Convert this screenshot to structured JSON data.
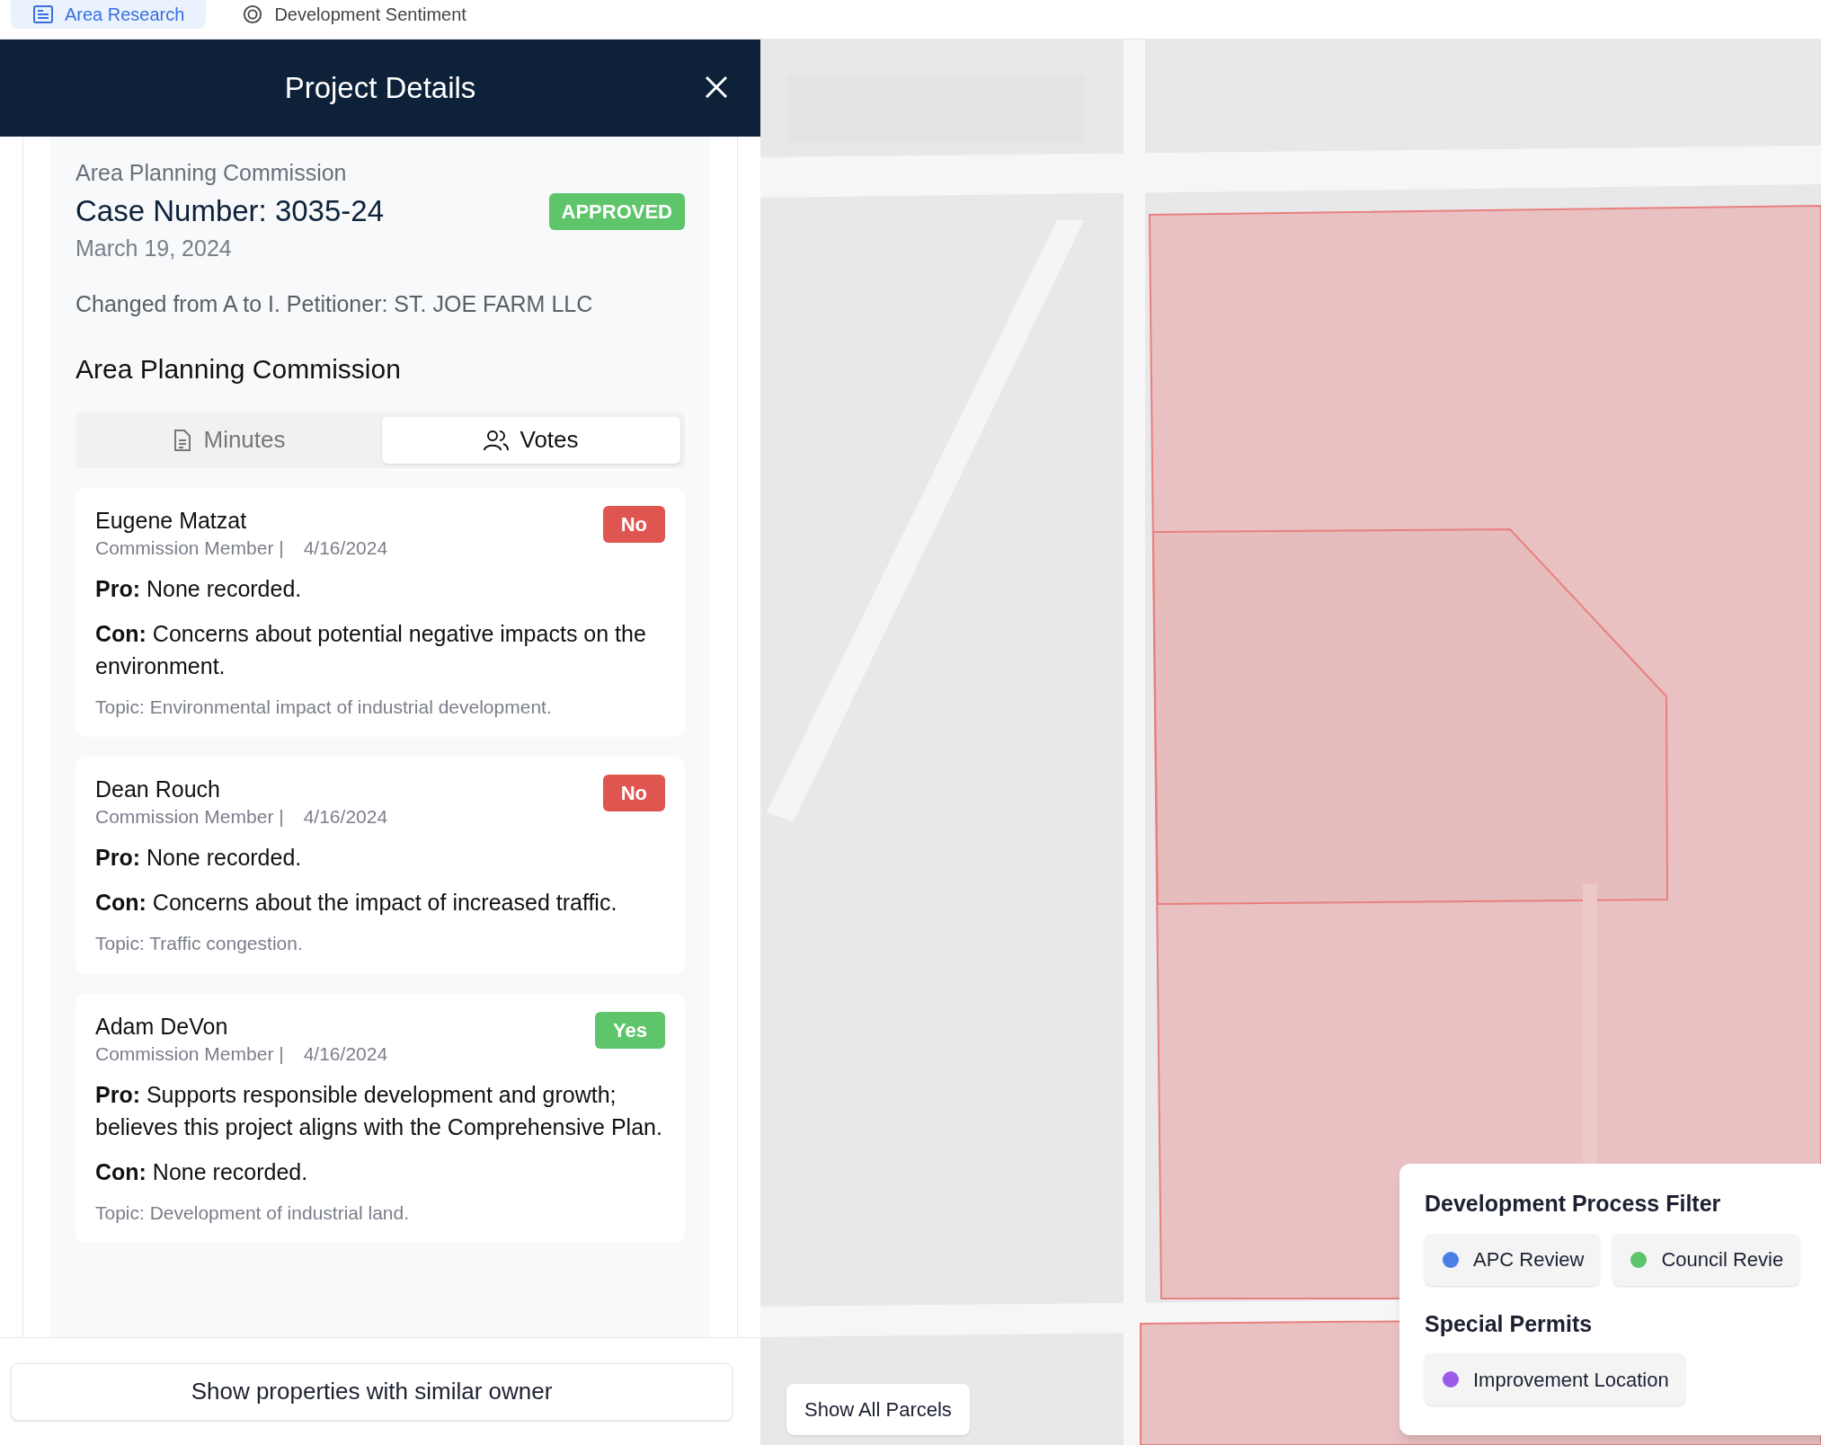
{
  "top_tabs": [
    {
      "label": "Area Research",
      "selected": true
    },
    {
      "label": "Development Sentiment",
      "selected": false
    }
  ],
  "panel": {
    "title": "Project Details",
    "case": {
      "body": "Area Planning Commission",
      "number": "Case Number: 3035-24",
      "status": "APPROVED",
      "date": "March 19, 2024",
      "description": "Changed from A to I. Petitioner: ST. JOE FARM LLC"
    },
    "section_title": "Area Planning Commission",
    "segments": [
      {
        "label": "Minutes",
        "selected": false
      },
      {
        "label": "Votes",
        "selected": true
      }
    ],
    "votes": [
      {
        "name": "Eugene Matzat",
        "role": "Commission Member |",
        "date": "4/16/2024",
        "vote": "No",
        "kind": "no",
        "pro": "**Pro:** None recorded.",
        "con": "**Con:** Concerns about potential negative impacts on the environment.",
        "topic": "Topic: Environmental impact of industrial development."
      },
      {
        "name": "Dean Rouch",
        "role": "Commission Member |",
        "date": "4/16/2024",
        "vote": "No",
        "kind": "no",
        "pro": "**Pro:** None recorded.",
        "con": "**Con:** Concerns about the impact of increased traffic.",
        "topic": "Topic: Traffic congestion."
      },
      {
        "name": "Adam DeVon",
        "role": "Commission Member |",
        "date": "4/16/2024",
        "vote": "Yes",
        "kind": "yes",
        "pro": "**Pro:** Supports responsible development and growth; believes this project aligns with the Comprehensive Plan.",
        "con": "**Con:** None recorded.",
        "topic": "Topic: Development of industrial land."
      }
    ],
    "footer_button": "Show properties with similar owner"
  },
  "map": {
    "show_parcels_button": "Show All Parcels",
    "legend": {
      "groups": [
        {
          "title": "Development Process Filter",
          "items": [
            {
              "label": "APC Review",
              "color": "#4a7fe8"
            },
            {
              "label": "Council Revie",
              "color": "#5cc46a"
            }
          ]
        },
        {
          "title": "Special Permits",
          "items": [
            {
              "label": "Improvement Location",
              "color": "#9b5ae8"
            }
          ]
        }
      ]
    }
  }
}
